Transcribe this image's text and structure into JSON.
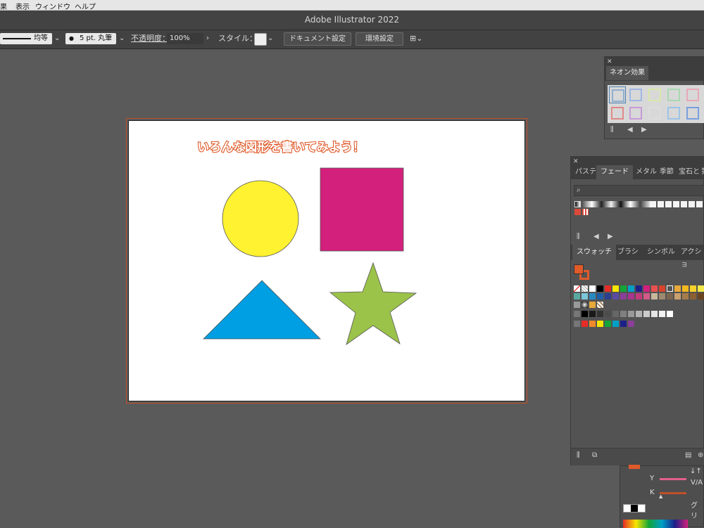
{
  "menu": [
    "果",
    "表示",
    "ウィンドウ",
    "ヘルプ"
  ],
  "app_title": "Adobe Illustrator 2022",
  "control": {
    "stroke_profile": "均等",
    "brush": "5 pt. 丸筆",
    "opacity_label": "不透明度：",
    "opacity_value": "100%",
    "style_label": "スタイル：",
    "doc_settings": "ドキュメント設定",
    "prefs": "環境設定"
  },
  "artwork": {
    "title": "いろんな図形を書いてみよう！",
    "shapes": [
      {
        "name": "circle",
        "color": "#fff231"
      },
      {
        "name": "square",
        "color": "#d3207c"
      },
      {
        "name": "triangle",
        "color": "#009fe3"
      },
      {
        "name": "star",
        "color": "#9bc34a"
      }
    ],
    "title_color": "#e05a2a"
  },
  "neon_panel": {
    "tab": "ネオン効果"
  },
  "gradient_panel": {
    "tabs": [
      "パステ",
      "フェード",
      "メタル",
      "季節",
      "宝石と",
      "第"
    ],
    "active_tab": "フェード"
  },
  "swatch_panel": {
    "tabs": [
      "スウォッチ",
      "ブラシ",
      "シンボル",
      "アクショ"
    ],
    "active_tab": "スウォッチ"
  },
  "color_panel": {
    "labels": [
      "Y",
      "K",
      "V/A",
      "グリ"
    ]
  }
}
